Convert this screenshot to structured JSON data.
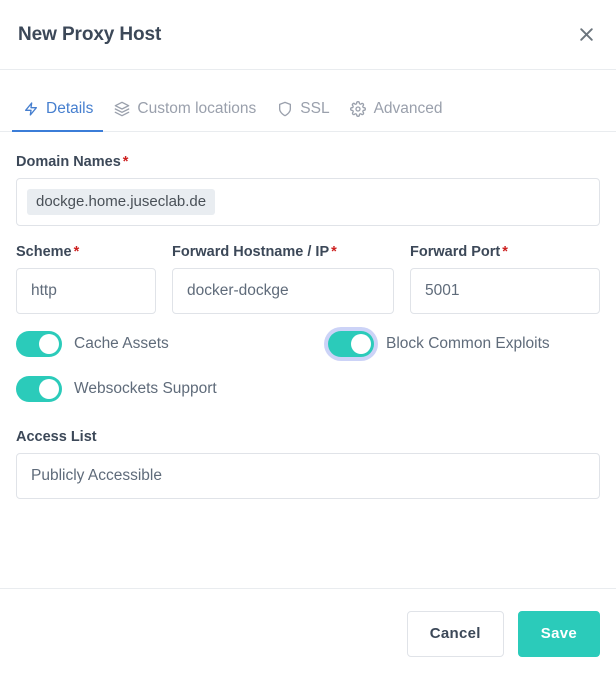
{
  "header": {
    "title": "New Proxy Host",
    "close_icon": "close-icon"
  },
  "tabs": [
    {
      "label": "Details",
      "icon": "lightning-bolt-icon",
      "active": true
    },
    {
      "label": "Custom locations",
      "icon": "layers-icon",
      "active": false
    },
    {
      "label": "SSL",
      "icon": "shield-icon",
      "active": false
    },
    {
      "label": "Advanced",
      "icon": "gear-icon",
      "active": false
    }
  ],
  "form": {
    "domain_names": {
      "label": "Domain Names",
      "required_marker": "*",
      "tags": [
        "dockge.home.juseclab.de"
      ],
      "placeholder": ""
    },
    "scheme": {
      "label": "Scheme",
      "required_marker": "*",
      "value": "http"
    },
    "forward_hostname": {
      "label": "Forward Hostname / IP",
      "required_marker": "*",
      "value": "docker-dockge"
    },
    "forward_port": {
      "label": "Forward Port",
      "required_marker": "*",
      "value": "5001"
    },
    "toggles": [
      {
        "label": "Cache Assets",
        "on": true,
        "focused": false
      },
      {
        "label": "Block Common Exploits",
        "on": true,
        "focused": true
      },
      {
        "label": "Websockets Support",
        "on": true,
        "focused": false
      }
    ],
    "access_list": {
      "label": "Access List",
      "value": "Publicly Accessible"
    }
  },
  "footer": {
    "cancel_label": "Cancel",
    "save_label": "Save"
  },
  "colors": {
    "accent_teal": "#2bcbba",
    "accent_blue": "#3b7dd8",
    "required_red": "#cd201f",
    "text_dark": "#3c4858",
    "text_muted": "#9aa0ac",
    "border": "#e9ecef",
    "tag_bg": "#e9edf1"
  }
}
